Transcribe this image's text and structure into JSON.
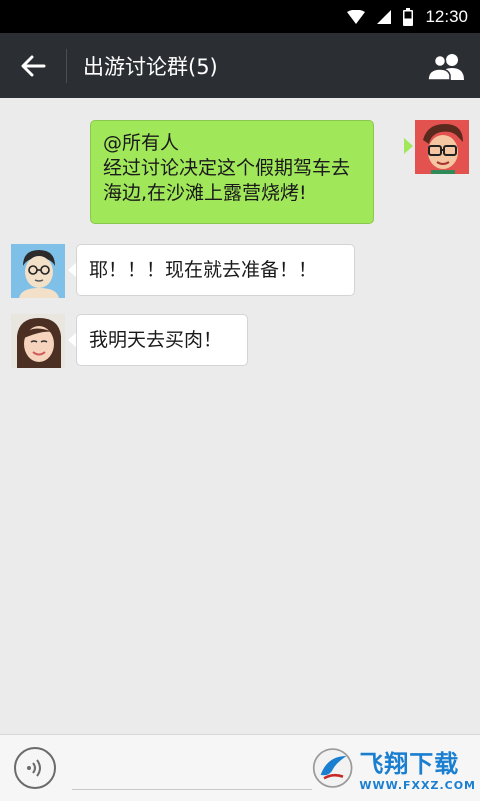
{
  "status_bar": {
    "time": "12:30",
    "icons": [
      "wifi-icon",
      "signal-icon",
      "battery-icon"
    ]
  },
  "header": {
    "title": "出游讨论群(5)",
    "back_icon": "arrow-left-icon",
    "members_icon": "group-members-icon"
  },
  "messages": [
    {
      "sender": "self",
      "lines": [
        "@所有人",
        "经过讨论决定这个假期驾车去",
        "海边,在沙滩上露营烧烤!"
      ]
    },
    {
      "sender": "friend-1",
      "text": "耶！！！现在就去准备！！"
    },
    {
      "sender": "friend-2",
      "text": "我明天去买肉！"
    }
  ],
  "input_bar": {
    "voice_icon": "voice-icon"
  },
  "watermark": {
    "text": "飞翔下载",
    "url": "WWW.FXXZ.COM"
  },
  "colors": {
    "title_bar": "#2b2f33",
    "chat_bg": "#ebebeb",
    "self_bubble": "#a0e75a",
    "watermark": "#1a7fd0"
  }
}
